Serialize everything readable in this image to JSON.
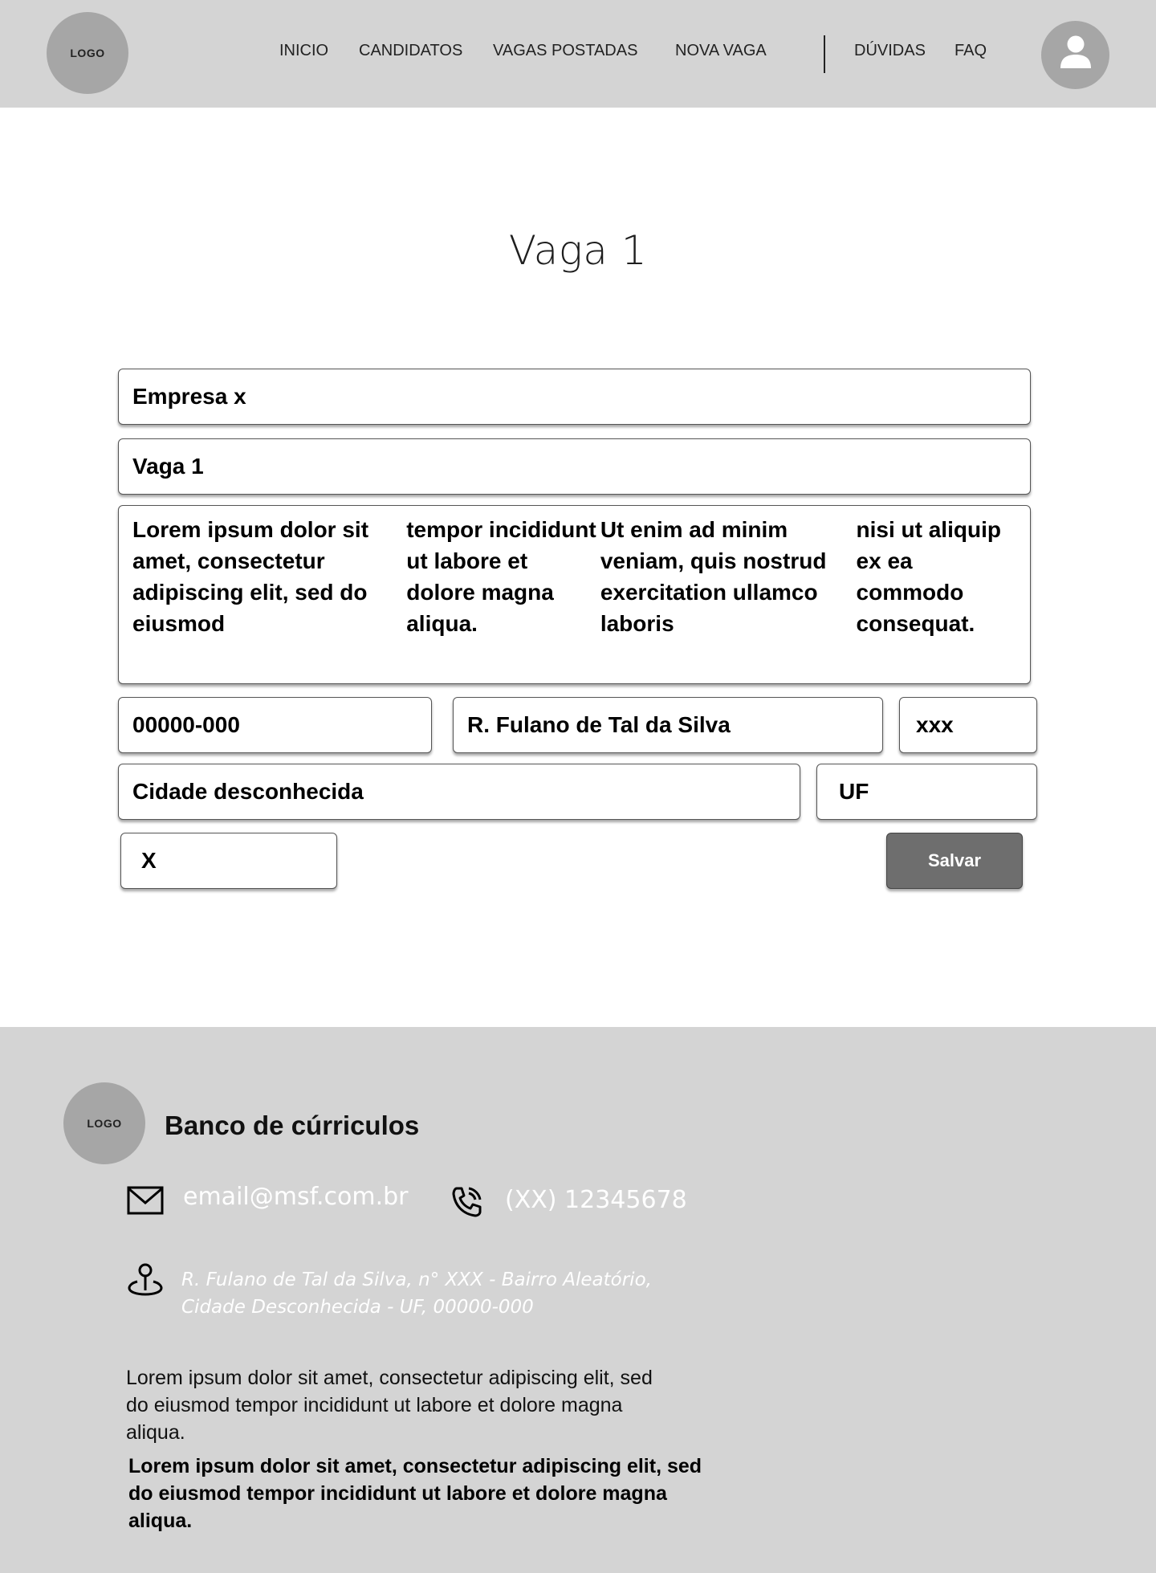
{
  "header": {
    "logo_text": "LOGO",
    "nav": [
      {
        "label": "INICIO"
      },
      {
        "label": "CANDIDATOS"
      },
      {
        "label": "VAGAS POSTADAS"
      },
      {
        "label": "NOVA VAGA"
      },
      {
        "label": "DÚVIDAS"
      },
      {
        "label": "FAQ"
      }
    ],
    "avatar_icon": "user-icon"
  },
  "main": {
    "title": "Vaga 1",
    "form": {
      "company": "Empresa x",
      "job_title": "Vaga 1",
      "description_lines": [
        "Lorem ipsum dolor sit amet, consectetur adipiscing elit, sed do eiusmod",
        "tempor incididunt ut labore et dolore magna aliqua.",
        "Ut enim ad minim veniam, quis nostrud exercitation ullamco laboris",
        "nisi ut aliquip ex ea commodo consequat."
      ],
      "cep": "00000-000",
      "street": "R. Fulano de Tal da Silva",
      "number": "xxx",
      "city": "Cidade desconhecida",
      "state": "UF",
      "extra": "X",
      "save_label": "Salvar"
    }
  },
  "footer": {
    "logo_text": "LOGO",
    "brand": "Banco de cúrriculos",
    "email": "email@msf.com.br",
    "email_icon": "mail-icon",
    "phone": "(XX) 12345678",
    "phone_icon": "phone-icon",
    "address_icon": "location-pin-icon",
    "address_lines": [
      "R. Fulano de Tal da Silva, n° XXX - Bairro Aleatório,",
      "Cidade Desconhecida - UF, 00000-000"
    ],
    "text_lines": [
      "Lorem ipsum dolor sit amet, consectetur adipiscing elit, sed",
      "do eiusmod tempor incididunt ut labore et dolore magna",
      "aliqua."
    ],
    "bold_text_lines": [
      "Lorem ipsum dolor sit amet, consectetur adipiscing elit, sed",
      "do eiusmod tempor incididunt ut labore et dolore magna",
      "aliqua."
    ],
    "colors": {
      "background": "#d4d4d4",
      "contact_text": "#ffffff"
    }
  }
}
